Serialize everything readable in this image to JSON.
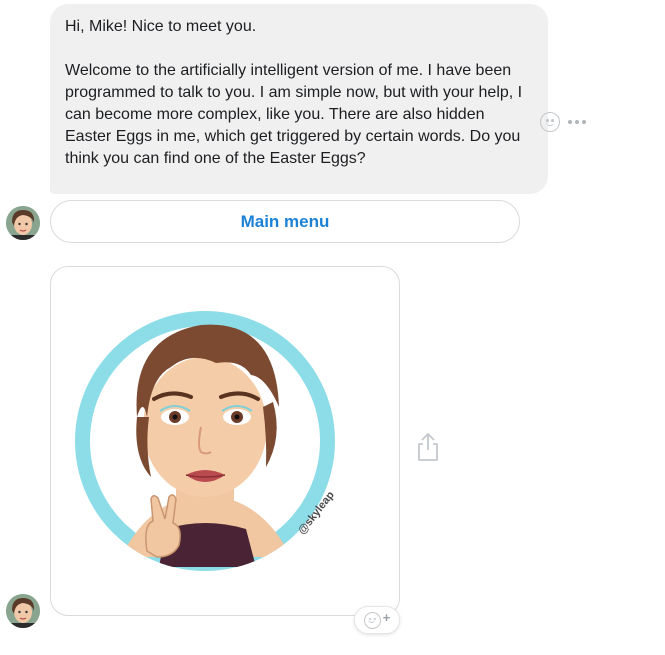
{
  "message": {
    "greeting": "Hi, Mike! Nice to meet you.",
    "body": "Welcome to the artificially intelligent version of me. I have been programmed to talk to you. I am simple now, but with your help, I can become more complex, like you. There are also hidden Easter Eggs in me, which get triggered by certain words. Do you think you can find one of the Easter Eggs?"
  },
  "quick_reply": {
    "label": "Main menu"
  },
  "image_card": {
    "watermark": "@skyleap",
    "circle_color": "#8ddde8",
    "icon": "bitmoji-avatar"
  },
  "icons": {
    "reaction": "smiley-icon",
    "more": "more-dots-icon",
    "share": "share-icon",
    "add_reaction": "add-reaction-icon"
  },
  "colors": {
    "bubble_bg": "#f0f0f0",
    "accent": "#1d82d6",
    "border": "#d8dade"
  }
}
